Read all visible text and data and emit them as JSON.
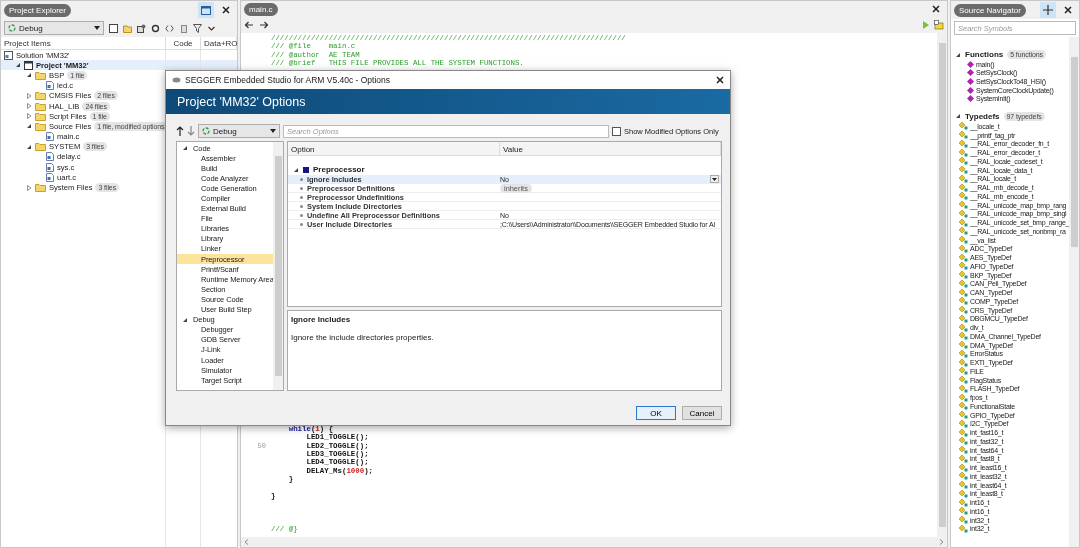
{
  "project_explorer": {
    "title": "Project Explorer",
    "configuration": "Debug",
    "columns": [
      "Project Items",
      "Code",
      "Data+RO"
    ],
    "tree": [
      {
        "label": "Solution 'MM32'",
        "kind": "solution",
        "selected": false,
        "children": [
          {
            "label": "Project 'MM32'",
            "kind": "project",
            "selected": true,
            "expanded": true,
            "children": [
              {
                "label": "BSP",
                "kind": "folder",
                "badge": "1 file",
                "selected": false,
                "expanded": true,
                "children": [
                  {
                    "label": "led.c",
                    "kind": "file",
                    "selected": false
                  }
                ]
              },
              {
                "label": "CMSIS Files",
                "kind": "folder",
                "badge": "2 files",
                "selected": false,
                "expanded": false
              },
              {
                "label": "HAL_LIB",
                "kind": "folder",
                "badge": "24 files",
                "selected": false,
                "expanded": false
              },
              {
                "label": "Script Files",
                "kind": "folder",
                "badge": "1 file",
                "selected": false,
                "expanded": false
              },
              {
                "label": "Source Files",
                "kind": "folder",
                "badge": "1 file, modified options",
                "selected": false,
                "expanded": true,
                "children": [
                  {
                    "label": "main.c",
                    "kind": "file",
                    "selected": false
                  }
                ]
              },
              {
                "label": "SYSTEM",
                "kind": "folder",
                "badge": "3 files",
                "selected": false,
                "expanded": true,
                "children": [
                  {
                    "label": "delay.c",
                    "kind": "file",
                    "selected": false
                  },
                  {
                    "label": "sys.c",
                    "kind": "file",
                    "selected": false
                  },
                  {
                    "label": "uart.c",
                    "kind": "file",
                    "selected": false
                  }
                ]
              },
              {
                "label": "System Files",
                "kind": "folder",
                "badge": "3 files",
                "selected": false,
                "expanded": false
              }
            ]
          }
        ]
      }
    ]
  },
  "editor": {
    "tab": "main.c",
    "code_top": [
      {
        "kind": "code",
        "segments": [
          {
            "text": "////////////////////////////////////////////////////////////////////////////////",
            "kind": "comment"
          }
        ]
      },
      {
        "kind": "code",
        "segments": [
          {
            "text": "/// @file    main.c",
            "kind": "comment"
          }
        ]
      },
      {
        "kind": "code",
        "segments": [
          {
            "text": "/// @author  AE TEAM",
            "kind": "comment"
          }
        ]
      },
      {
        "kind": "code",
        "segments": [
          {
            "text": "/// @brief   THIS FILE PROVIDES ALL THE SYSTEM FUNCTIONS.",
            "kind": "comment"
          }
        ]
      }
    ],
    "code_bottom": [
      {
        "kind": "block",
        "children": [
          {
            "kind": "code",
            "segments": [
              {
                "text": "while",
                "kind": "keyword"
              },
              {
                "text": "(",
                "kind": "text"
              },
              {
                "text": "1",
                "kind": "number"
              },
              {
                "text": ") {",
                "kind": "text"
              }
            ],
            "children": [
              {
                "kind": "code",
                "segments": [
                  {
                    "text": "LED1_TOGGLE();",
                    "kind": "text"
                  }
                ]
              },
              {
                "kind": "code",
                "number": "50",
                "segments": [
                  {
                    "text": "LED2_TOGGLE();",
                    "kind": "text"
                  }
                ]
              },
              {
                "kind": "code",
                "segments": [
                  {
                    "text": "LED3_TOGGLE();",
                    "kind": "text"
                  }
                ]
              },
              {
                "kind": "code",
                "segments": [
                  {
                    "text": "LED4_TOGGLE();",
                    "kind": "text"
                  }
                ]
              },
              {
                "kind": "code",
                "segments": [
                  {
                    "text": "DELAY_Ms(",
                    "kind": "text"
                  },
                  {
                    "text": "1000",
                    "kind": "number"
                  },
                  {
                    "text": ");",
                    "kind": "text"
                  }
                ]
              }
            ]
          },
          {
            "kind": "code",
            "segments": [
              {
                "text": "}",
                "kind": "text"
              }
            ]
          }
        ]
      },
      {
        "kind": "blank"
      },
      {
        "kind": "code",
        "segments": [
          {
            "text": "}",
            "kind": "text"
          }
        ]
      },
      {
        "kind": "blank"
      },
      {
        "kind": "blank"
      },
      {
        "kind": "blank"
      },
      {
        "kind": "code",
        "segments": [
          {
            "text": "/// @}",
            "kind": "comment"
          }
        ]
      }
    ]
  },
  "dialog": {
    "window_title": "SEGGER Embedded Studio for ARM V5.40c - Options",
    "heading": "Project 'MM32' Options",
    "configuration": "Debug",
    "search": {
      "placeholder": "Search Options"
    },
    "show_modified": {
      "label": "Show Modified Options Only",
      "checked": false
    },
    "categories": [
      {
        "label": "Code",
        "expanded": true,
        "children": [
          {
            "label": "Assembler",
            "selected": false
          },
          {
            "label": "Build",
            "selected": false
          },
          {
            "label": "Code Analyzer",
            "selected": false
          },
          {
            "label": "Code Generation",
            "selected": false
          },
          {
            "label": "Compiler",
            "selected": false
          },
          {
            "label": "External Build",
            "selected": false
          },
          {
            "label": "File",
            "selected": false
          },
          {
            "label": "Libraries",
            "selected": false
          },
          {
            "label": "Library",
            "selected": false
          },
          {
            "label": "Linker",
            "selected": false
          },
          {
            "label": "Preprocessor",
            "selected": true
          },
          {
            "label": "Printf/Scanf",
            "selected": false
          },
          {
            "label": "Runtime Memory Area",
            "selected": false
          },
          {
            "label": "Section",
            "selected": false
          },
          {
            "label": "Source Code",
            "selected": false
          },
          {
            "label": "User Build Step",
            "selected": false
          }
        ]
      },
      {
        "label": "Debug",
        "expanded": true,
        "children": [
          {
            "label": "Debugger",
            "selected": false
          },
          {
            "label": "GDB Server",
            "selected": false
          },
          {
            "label": "J-Link",
            "selected": false
          },
          {
            "label": "Loader",
            "selected": false
          },
          {
            "label": "Simulator",
            "selected": false
          },
          {
            "label": "Target Script",
            "selected": false
          }
        ]
      }
    ],
    "options_table": {
      "columns": [
        "Option",
        "Value"
      ],
      "group": {
        "label": "Preprocessor",
        "expanded": true
      },
      "rows": [
        {
          "option": "Ignore Includes",
          "value": "No",
          "kind": "value",
          "selected": true,
          "dropdown": true
        },
        {
          "option": "Preprocessor Definitions",
          "value": "inherits",
          "kind": "inherited",
          "selected": false,
          "dropdown": false
        },
        {
          "option": "Preprocessor Undefinitions",
          "selected": false,
          "dropdown": false
        },
        {
          "option": "System Include Directories",
          "selected": false,
          "dropdown": false
        },
        {
          "option": "Undefine All Preprocessor Definitions",
          "value": "No",
          "kind": "value",
          "selected": false,
          "dropdown": false
        },
        {
          "option": "User Include Directories",
          "value": ";C:\\\\Users\\\\Administrator\\\\Documents\\\\SEGGER Embedded Studio for Al",
          "kind": "value",
          "selected": false,
          "dropdown": false
        }
      ]
    },
    "description": {
      "title": "Ignore Includes",
      "text": "Ignore the include directories properties."
    },
    "buttons": [
      {
        "label": "OK",
        "default": true
      },
      {
        "label": "Cancel",
        "default": false
      }
    ]
  },
  "source_navigator": {
    "title": "Source Navigator",
    "search": {
      "placeholder": "Search Symbols"
    },
    "sections": [
      {
        "title": "Functions",
        "count": "5 functions",
        "kind": "function",
        "expanded": true,
        "items": [
          "main()",
          "SetSysClock()",
          "SetSysClockTo48_HSI()",
          "SystemCoreClockUpdate()",
          "SystemInit()"
        ]
      },
      {
        "title": "Typedefs",
        "count": "97 typedefs",
        "kind": "typedef",
        "expanded": true,
        "items": [
          "__locale_t",
          "__printf_tag_ptr",
          "__RAL_error_decoder_fn_t",
          "__RAL_error_decoder_t",
          "__RAL_locale_codeset_t",
          "__RAL_locale_data_t",
          "__RAL_locale_t",
          "__RAL_mb_decode_t",
          "__RAL_mb_encode_t",
          "__RAL_unicode_map_bmp_rang",
          "__RAL_unicode_map_bmp_singl",
          "__RAL_unicode_set_bmp_range_",
          "__RAL_unicode_set_nonbmp_ra",
          "__va_list",
          "ADC_TypeDef",
          "AES_TypeDef",
          "AFIO_TypeDef",
          "BKP_TypeDef",
          "CAN_Peli_TypeDef",
          "CAN_TypeDef",
          "COMP_TypeDef",
          "CRS_TypeDef",
          "DBGMCU_TypeDef",
          "div_t",
          "DMA_Channel_TypeDef",
          "DMA_TypeDef",
          "ErrorStatus",
          "EXTI_TypeDef",
          "FILE",
          "FlagStatus",
          "FLASH_TypeDef",
          "fpos_t",
          "FunctionalState",
          "GPIO_TypeDef",
          "I2C_TypeDef",
          "int_fast16_t",
          "int_fast32_t",
          "int_fast64_t",
          "int_fast8_t",
          "int_least16_t",
          "int_least32_t",
          "int_least64_t",
          "int_least8_t",
          "int16_t",
          "int16_t",
          "int32_t",
          "int32_t"
        ]
      }
    ]
  }
}
